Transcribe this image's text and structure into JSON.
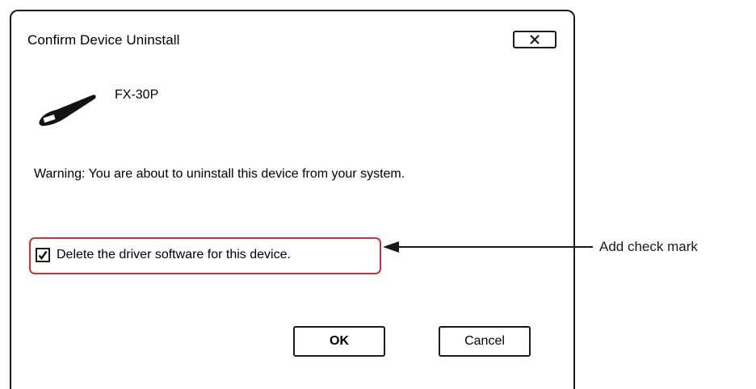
{
  "dialog": {
    "title": "Confirm Device Uninstall",
    "close_icon": "close-icon",
    "device_icon": "usb-cable-icon",
    "device_name": "FX-30P",
    "warning": "Warning: You are about to uninstall this device from your system.",
    "checkbox": {
      "label": "Delete the driver software for this device.",
      "checked": true
    },
    "ok_label": "OK",
    "cancel_label": "Cancel"
  },
  "annotation": {
    "text": "Add check mark",
    "highlight_color": "#d32f2f"
  }
}
